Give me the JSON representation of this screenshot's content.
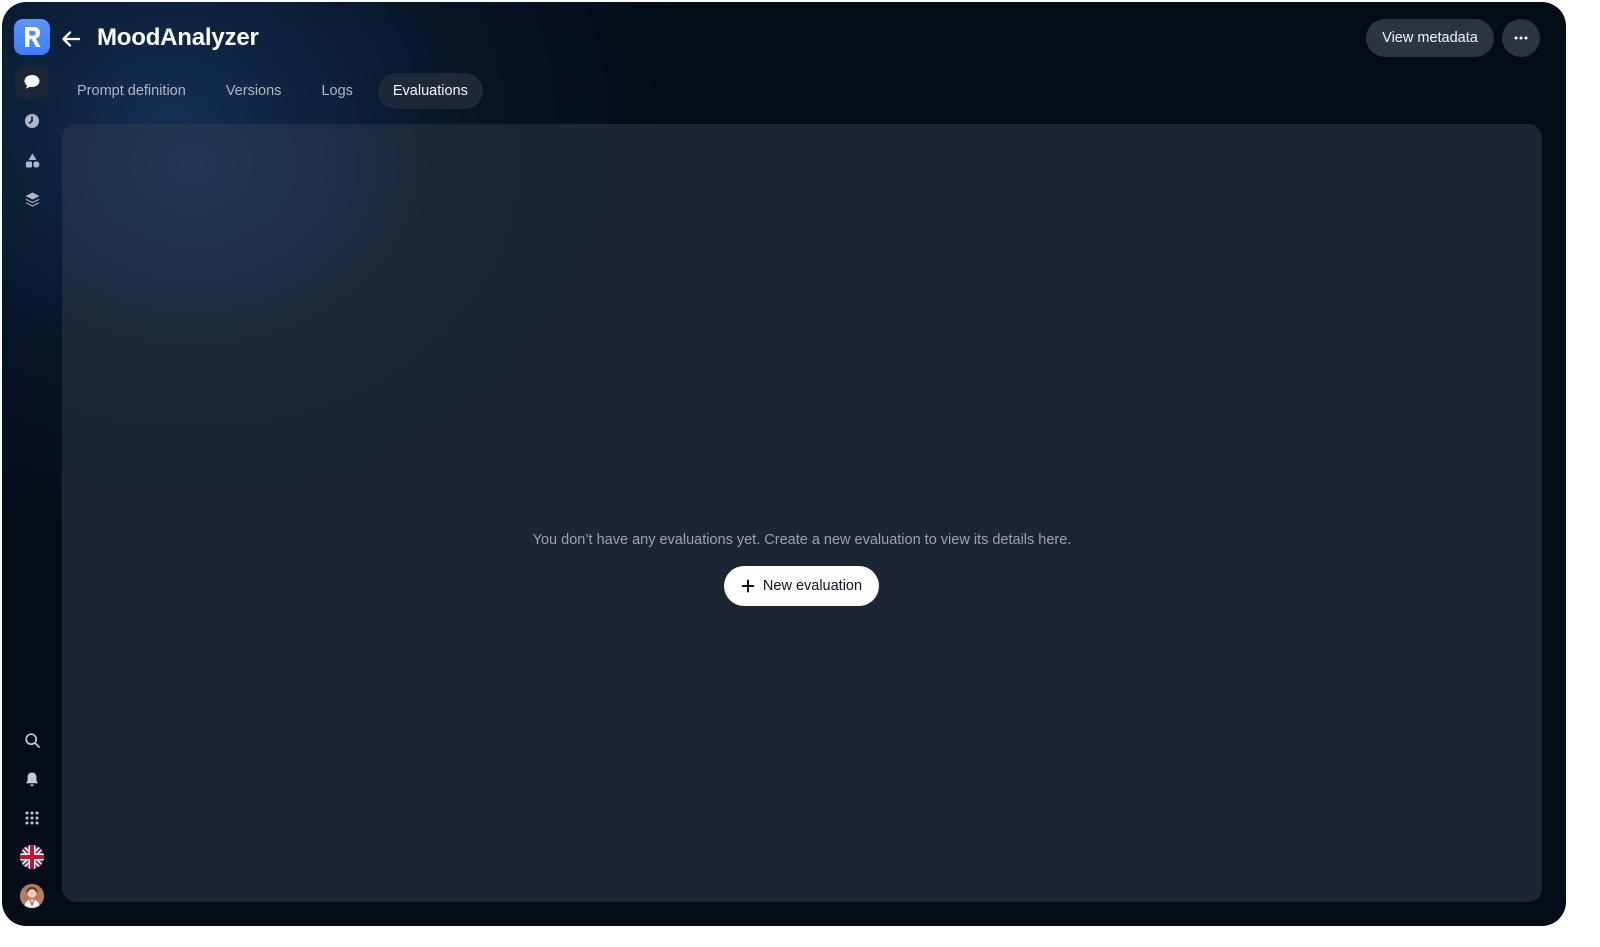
{
  "app": {
    "title": "MoodAnalyzer",
    "logo_letter": "R",
    "accent_color": "#3d7dff"
  },
  "sidebar": {
    "top_items": [
      {
        "icon": "chat-bubble-icon",
        "active": true
      },
      {
        "icon": "clock-icon",
        "active": false
      },
      {
        "icon": "shapes-icon",
        "active": false
      },
      {
        "icon": "layers-icon",
        "active": false
      }
    ],
    "bottom_items": [
      {
        "icon": "search-icon"
      },
      {
        "icon": "bell-icon"
      },
      {
        "icon": "apps-grid-icon"
      },
      {
        "icon": "uk-flag-icon"
      },
      {
        "icon": "user-avatar"
      }
    ]
  },
  "header": {
    "back_icon": "arrow-left-icon",
    "view_metadata_label": "View metadata",
    "more_icon": "ellipsis-icon"
  },
  "tabs": [
    {
      "label": "Prompt definition",
      "active": false
    },
    {
      "label": "Versions",
      "active": false
    },
    {
      "label": "Logs",
      "active": false
    },
    {
      "label": "Evaluations",
      "active": true
    }
  ],
  "empty_state": {
    "message": "You don’t have any evaluations yet. Create a new evaluation to view its details here.",
    "button_label": "New evaluation",
    "button_icon": "plus-icon"
  }
}
